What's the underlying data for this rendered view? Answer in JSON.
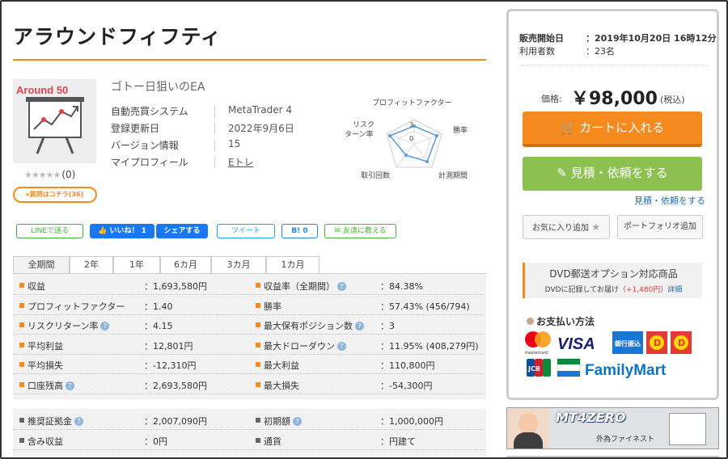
{
  "product": {
    "title": "アラウンドフィフティ",
    "image_logo": "Around 50",
    "subtitle": "ゴトー日狙いのEA",
    "rating_stars": "★★★★★",
    "rating_count": "(0)",
    "qa_label": "▸質問はコチラ(36)"
  },
  "info": [
    {
      "key": "自動売買システム",
      "value": "MetaTrader 4"
    },
    {
      "key": "登録更新日",
      "value": "2022年9月6日"
    },
    {
      "key": "バージョン情報",
      "value": "15"
    },
    {
      "key": "マイプロフィール",
      "value": "Eトレ"
    }
  ],
  "radar": {
    "labels": {
      "top": "プロフィットファクター",
      "right": "勝率",
      "bottom_right": "計測期間",
      "bottom_left": "取引回数",
      "left_line1": "リスク",
      "left_line2": "ターン率"
    },
    "scale_max": "3",
    "scale_min": "0",
    "line_color": "#5b9bd5"
  },
  "social": {
    "line": "LINEで送る",
    "like": "👍 いいね！ 1",
    "share": "シェアする",
    "tweet": "ツイート",
    "hatena": "B! 0",
    "friend": "✉ 友達に教える"
  },
  "tabs": [
    "全期間",
    "2年",
    "1年",
    "6カ月",
    "3カ月",
    "1カ月"
  ],
  "stats_left": [
    {
      "label": "収益",
      "value": "：1,693,580円",
      "help": false
    },
    {
      "label": "プロフィットファクター",
      "value": "：1.40",
      "help": false
    },
    {
      "label": "リスクリターン率",
      "value": "：4.15",
      "help": true
    },
    {
      "label": "平均利益",
      "value": "：12,801円",
      "help": false
    },
    {
      "label": "平均損失",
      "value": "：-12,310円",
      "help": false
    },
    {
      "label": "口座残高",
      "value": "：2,693,580円",
      "help": true
    }
  ],
  "stats_right": [
    {
      "label": "収益率（全期間）",
      "value": "：84.38%",
      "help": true
    },
    {
      "label": "勝率",
      "value": "：57.43% (456/794)",
      "help": false
    },
    {
      "label": "最大保有ポジション数",
      "value": "：3",
      "help": true
    },
    {
      "label": "最大ドローダウン",
      "value": "：11.95% (408,279円)",
      "help": true
    },
    {
      "label": "最大利益",
      "value": "：110,800円",
      "help": false
    },
    {
      "label": "最大損失",
      "value": "：-54,300円",
      "help": false
    }
  ],
  "stats2_left": [
    {
      "label": "推奨証拠金",
      "value": "：2,007,090円",
      "help": true
    },
    {
      "label": "含み収益",
      "value": "：0円",
      "help": false
    }
  ],
  "stats2_right": [
    {
      "label": "初期額",
      "value": "：1,000,000円",
      "help": true
    },
    {
      "label": "通貨",
      "value": "：円建て",
      "help": false
    }
  ],
  "purchase": {
    "sale_start_label": "販売開始日",
    "sale_start_value": "：2019年10月20日 16時12分",
    "users_label": "利用者数",
    "users_value": "：23名",
    "price_label": "価格:",
    "price": "￥98,000",
    "tax": "(税込)",
    "cart_button": "カートに入れる",
    "quote_button": "見積・依頼をする",
    "quote_link": "見積・依頼をする",
    "favorite_button": "お気に入り追加",
    "portfolio_button": "ポートフォリオ追加",
    "dvd_title": "DVD郵送オプション対応商品",
    "dvd_text": "DVDに記録してお届け",
    "dvd_price": "（+1,480円）",
    "dvd_link": "詳細",
    "payment_title": "お支払い方法",
    "payment": {
      "mastercard": "mastercard",
      "visa": "VISA",
      "bank": "銀行振込",
      "jcb": "JCB",
      "familymart": "FamilyMart"
    }
  },
  "ad": {
    "title": "MT4ZERO",
    "subtitle": "外為ファイネスト"
  },
  "colors": {
    "accent": "#f58a1f",
    "green": "#8cc152",
    "link": "#2b6cb0"
  }
}
